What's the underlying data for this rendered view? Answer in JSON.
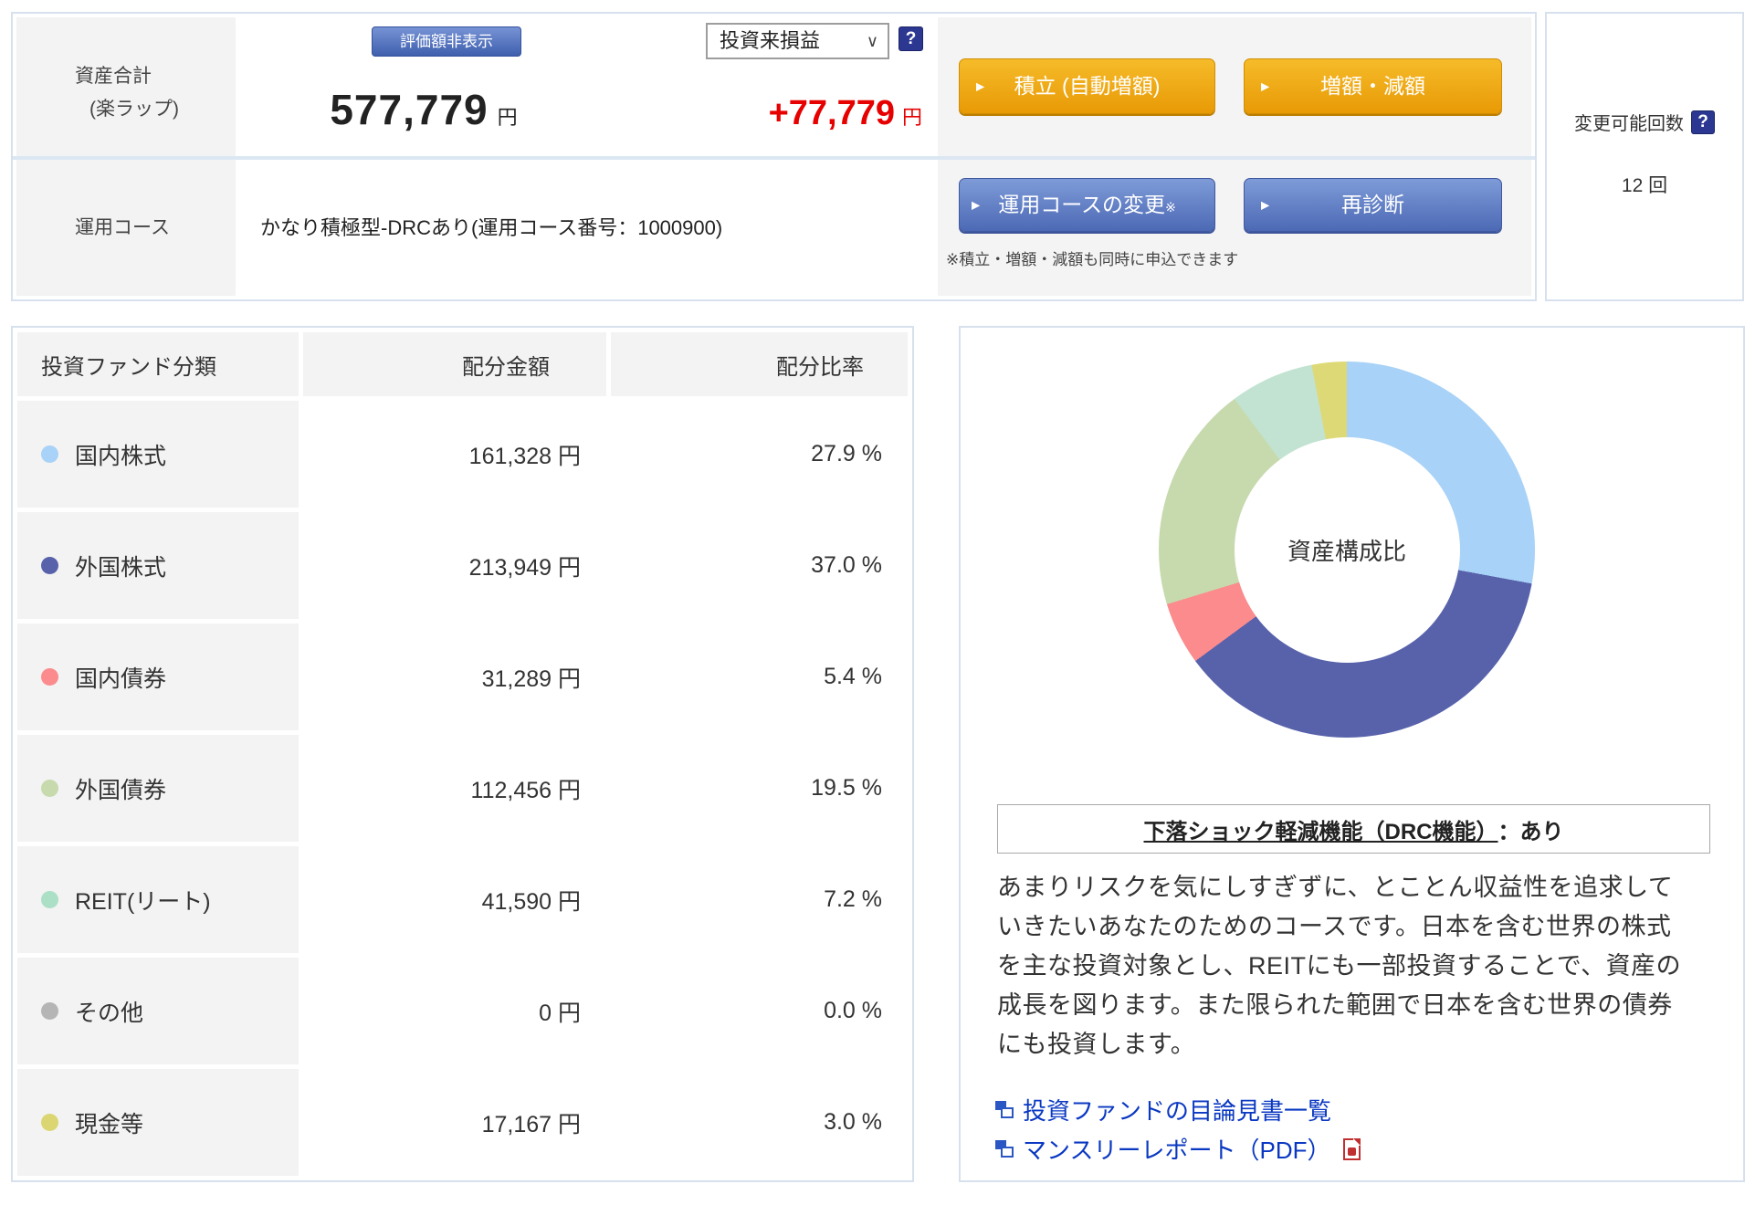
{
  "summary": {
    "asset_label_line1": "資産合計",
    "asset_label_line2": "(楽ラップ)",
    "hide_value_button": "評価額非表示",
    "total_amount": "577,779",
    "total_unit": "円",
    "pl_dropdown_value": "投資来損益",
    "pl_amount": "+77,779",
    "pl_unit": "円",
    "tsumitate_button": "積立 (自動増額)",
    "zougaku_button": "増額・減額",
    "course_label": "運用コース",
    "course_value": "かなり積極型-DRCあり(運用コース番号：1000900)",
    "course_change_button": "運用コースの変更",
    "course_change_mark": "※",
    "rediagnose_button": "再診断",
    "apply_note": "※積立・増額・減額も同時に申込できます",
    "help_glyph": "?"
  },
  "change_panel": {
    "label": "変更可能回数",
    "count": "12 回"
  },
  "table": {
    "headers": [
      "投資ファンド分類",
      "配分金額",
      "配分比率"
    ],
    "rows": [
      {
        "label": "国内株式",
        "amount": "161,328 円",
        "ratio": "27.9 %",
        "color": "#a8d2f7"
      },
      {
        "label": "外国株式",
        "amount": "213,949 円",
        "ratio": "37.0 %",
        "color": "#5762ab"
      },
      {
        "label": "国内債券",
        "amount": "31,289 円",
        "ratio": "5.4 %",
        "color": "#fb8b8d"
      },
      {
        "label": "外国債券",
        "amount": "112,456 円",
        "ratio": "19.5 %",
        "color": "#c7daae"
      },
      {
        "label": "REIT(リート)",
        "amount": "41,590 円",
        "ratio": "7.2 %",
        "color": "#abe0c6"
      },
      {
        "label": "その他",
        "amount": "0 円",
        "ratio": "0.0 %",
        "color": "#b5b5b5"
      },
      {
        "label": "現金等",
        "amount": "17,167 円",
        "ratio": "3.0 %",
        "color": "#dcd672"
      }
    ]
  },
  "chart_data": {
    "type": "pie",
    "subtype": "donut",
    "title": "資産構成比",
    "center_label": "資産構成比",
    "categories": [
      "国内株式",
      "外国株式",
      "国内債券",
      "外国債券",
      "REIT(リート)",
      "その他",
      "現金等"
    ],
    "values": [
      27.9,
      37.0,
      5.4,
      19.5,
      7.2,
      0.0,
      3.0
    ],
    "amounts_yen": [
      161328,
      213949,
      31289,
      112456,
      41590,
      0,
      17167
    ],
    "colors": [
      "#a8d2f7",
      "#5762ab",
      "#fb8b8d",
      "#c7daae",
      "#c2e3d1",
      "#b5b5b5",
      "#ded977"
    ],
    "start_angle_deg": 0,
    "direction": "clockwise",
    "inner_radius_ratio": 0.6,
    "legend_position": "none"
  },
  "drc": {
    "heading_underlined": "下落ショック軽減機能（DRC機能）",
    "heading_suffix": "：あり",
    "description_lines": [
      "あまりリスクを気にしすぎずに、とことん収益性を追求して",
      "いきたいあなたのためのコースです。日本を含む世界の株式",
      "を主な投資対象とし、REITにも一部投資することで、資産の",
      "成長を図ります。また限られた範囲で日本を含む世界の債券",
      "にも投資します。"
    ]
  },
  "links": {
    "prospectus": "投資ファンドの目論見書一覧",
    "monthly_report": "マンスリーレポート（PDF）"
  }
}
